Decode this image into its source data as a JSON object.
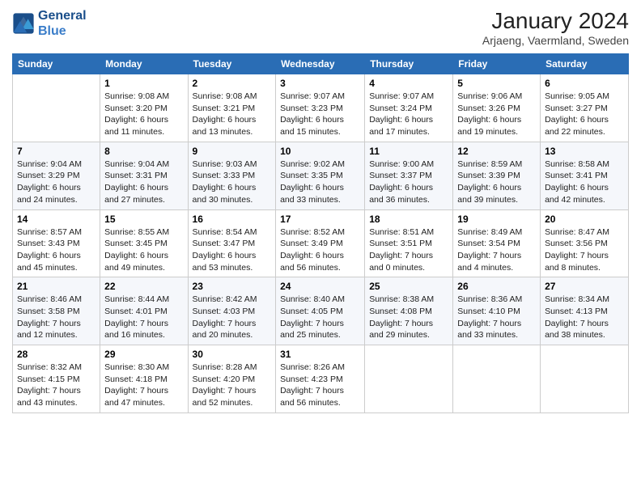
{
  "logo": {
    "line1": "General",
    "line2": "Blue"
  },
  "title": "January 2024",
  "subtitle": "Arjaeng, Vaermland, Sweden",
  "days_header": [
    "Sunday",
    "Monday",
    "Tuesday",
    "Wednesday",
    "Thursday",
    "Friday",
    "Saturday"
  ],
  "weeks": [
    [
      {
        "day": "",
        "info": ""
      },
      {
        "day": "1",
        "info": "Sunrise: 9:08 AM\nSunset: 3:20 PM\nDaylight: 6 hours\nand 11 minutes."
      },
      {
        "day": "2",
        "info": "Sunrise: 9:08 AM\nSunset: 3:21 PM\nDaylight: 6 hours\nand 13 minutes."
      },
      {
        "day": "3",
        "info": "Sunrise: 9:07 AM\nSunset: 3:23 PM\nDaylight: 6 hours\nand 15 minutes."
      },
      {
        "day": "4",
        "info": "Sunrise: 9:07 AM\nSunset: 3:24 PM\nDaylight: 6 hours\nand 17 minutes."
      },
      {
        "day": "5",
        "info": "Sunrise: 9:06 AM\nSunset: 3:26 PM\nDaylight: 6 hours\nand 19 minutes."
      },
      {
        "day": "6",
        "info": "Sunrise: 9:05 AM\nSunset: 3:27 PM\nDaylight: 6 hours\nand 22 minutes."
      }
    ],
    [
      {
        "day": "7",
        "info": "Sunrise: 9:04 AM\nSunset: 3:29 PM\nDaylight: 6 hours\nand 24 minutes."
      },
      {
        "day": "8",
        "info": "Sunrise: 9:04 AM\nSunset: 3:31 PM\nDaylight: 6 hours\nand 27 minutes."
      },
      {
        "day": "9",
        "info": "Sunrise: 9:03 AM\nSunset: 3:33 PM\nDaylight: 6 hours\nand 30 minutes."
      },
      {
        "day": "10",
        "info": "Sunrise: 9:02 AM\nSunset: 3:35 PM\nDaylight: 6 hours\nand 33 minutes."
      },
      {
        "day": "11",
        "info": "Sunrise: 9:00 AM\nSunset: 3:37 PM\nDaylight: 6 hours\nand 36 minutes."
      },
      {
        "day": "12",
        "info": "Sunrise: 8:59 AM\nSunset: 3:39 PM\nDaylight: 6 hours\nand 39 minutes."
      },
      {
        "day": "13",
        "info": "Sunrise: 8:58 AM\nSunset: 3:41 PM\nDaylight: 6 hours\nand 42 minutes."
      }
    ],
    [
      {
        "day": "14",
        "info": "Sunrise: 8:57 AM\nSunset: 3:43 PM\nDaylight: 6 hours\nand 45 minutes."
      },
      {
        "day": "15",
        "info": "Sunrise: 8:55 AM\nSunset: 3:45 PM\nDaylight: 6 hours\nand 49 minutes."
      },
      {
        "day": "16",
        "info": "Sunrise: 8:54 AM\nSunset: 3:47 PM\nDaylight: 6 hours\nand 53 minutes."
      },
      {
        "day": "17",
        "info": "Sunrise: 8:52 AM\nSunset: 3:49 PM\nDaylight: 6 hours\nand 56 minutes."
      },
      {
        "day": "18",
        "info": "Sunrise: 8:51 AM\nSunset: 3:51 PM\nDaylight: 7 hours\nand 0 minutes."
      },
      {
        "day": "19",
        "info": "Sunrise: 8:49 AM\nSunset: 3:54 PM\nDaylight: 7 hours\nand 4 minutes."
      },
      {
        "day": "20",
        "info": "Sunrise: 8:47 AM\nSunset: 3:56 PM\nDaylight: 7 hours\nand 8 minutes."
      }
    ],
    [
      {
        "day": "21",
        "info": "Sunrise: 8:46 AM\nSunset: 3:58 PM\nDaylight: 7 hours\nand 12 minutes."
      },
      {
        "day": "22",
        "info": "Sunrise: 8:44 AM\nSunset: 4:01 PM\nDaylight: 7 hours\nand 16 minutes."
      },
      {
        "day": "23",
        "info": "Sunrise: 8:42 AM\nSunset: 4:03 PM\nDaylight: 7 hours\nand 20 minutes."
      },
      {
        "day": "24",
        "info": "Sunrise: 8:40 AM\nSunset: 4:05 PM\nDaylight: 7 hours\nand 25 minutes."
      },
      {
        "day": "25",
        "info": "Sunrise: 8:38 AM\nSunset: 4:08 PM\nDaylight: 7 hours\nand 29 minutes."
      },
      {
        "day": "26",
        "info": "Sunrise: 8:36 AM\nSunset: 4:10 PM\nDaylight: 7 hours\nand 33 minutes."
      },
      {
        "day": "27",
        "info": "Sunrise: 8:34 AM\nSunset: 4:13 PM\nDaylight: 7 hours\nand 38 minutes."
      }
    ],
    [
      {
        "day": "28",
        "info": "Sunrise: 8:32 AM\nSunset: 4:15 PM\nDaylight: 7 hours\nand 43 minutes."
      },
      {
        "day": "29",
        "info": "Sunrise: 8:30 AM\nSunset: 4:18 PM\nDaylight: 7 hours\nand 47 minutes."
      },
      {
        "day": "30",
        "info": "Sunrise: 8:28 AM\nSunset: 4:20 PM\nDaylight: 7 hours\nand 52 minutes."
      },
      {
        "day": "31",
        "info": "Sunrise: 8:26 AM\nSunset: 4:23 PM\nDaylight: 7 hours\nand 56 minutes."
      },
      {
        "day": "",
        "info": ""
      },
      {
        "day": "",
        "info": ""
      },
      {
        "day": "",
        "info": ""
      }
    ]
  ]
}
